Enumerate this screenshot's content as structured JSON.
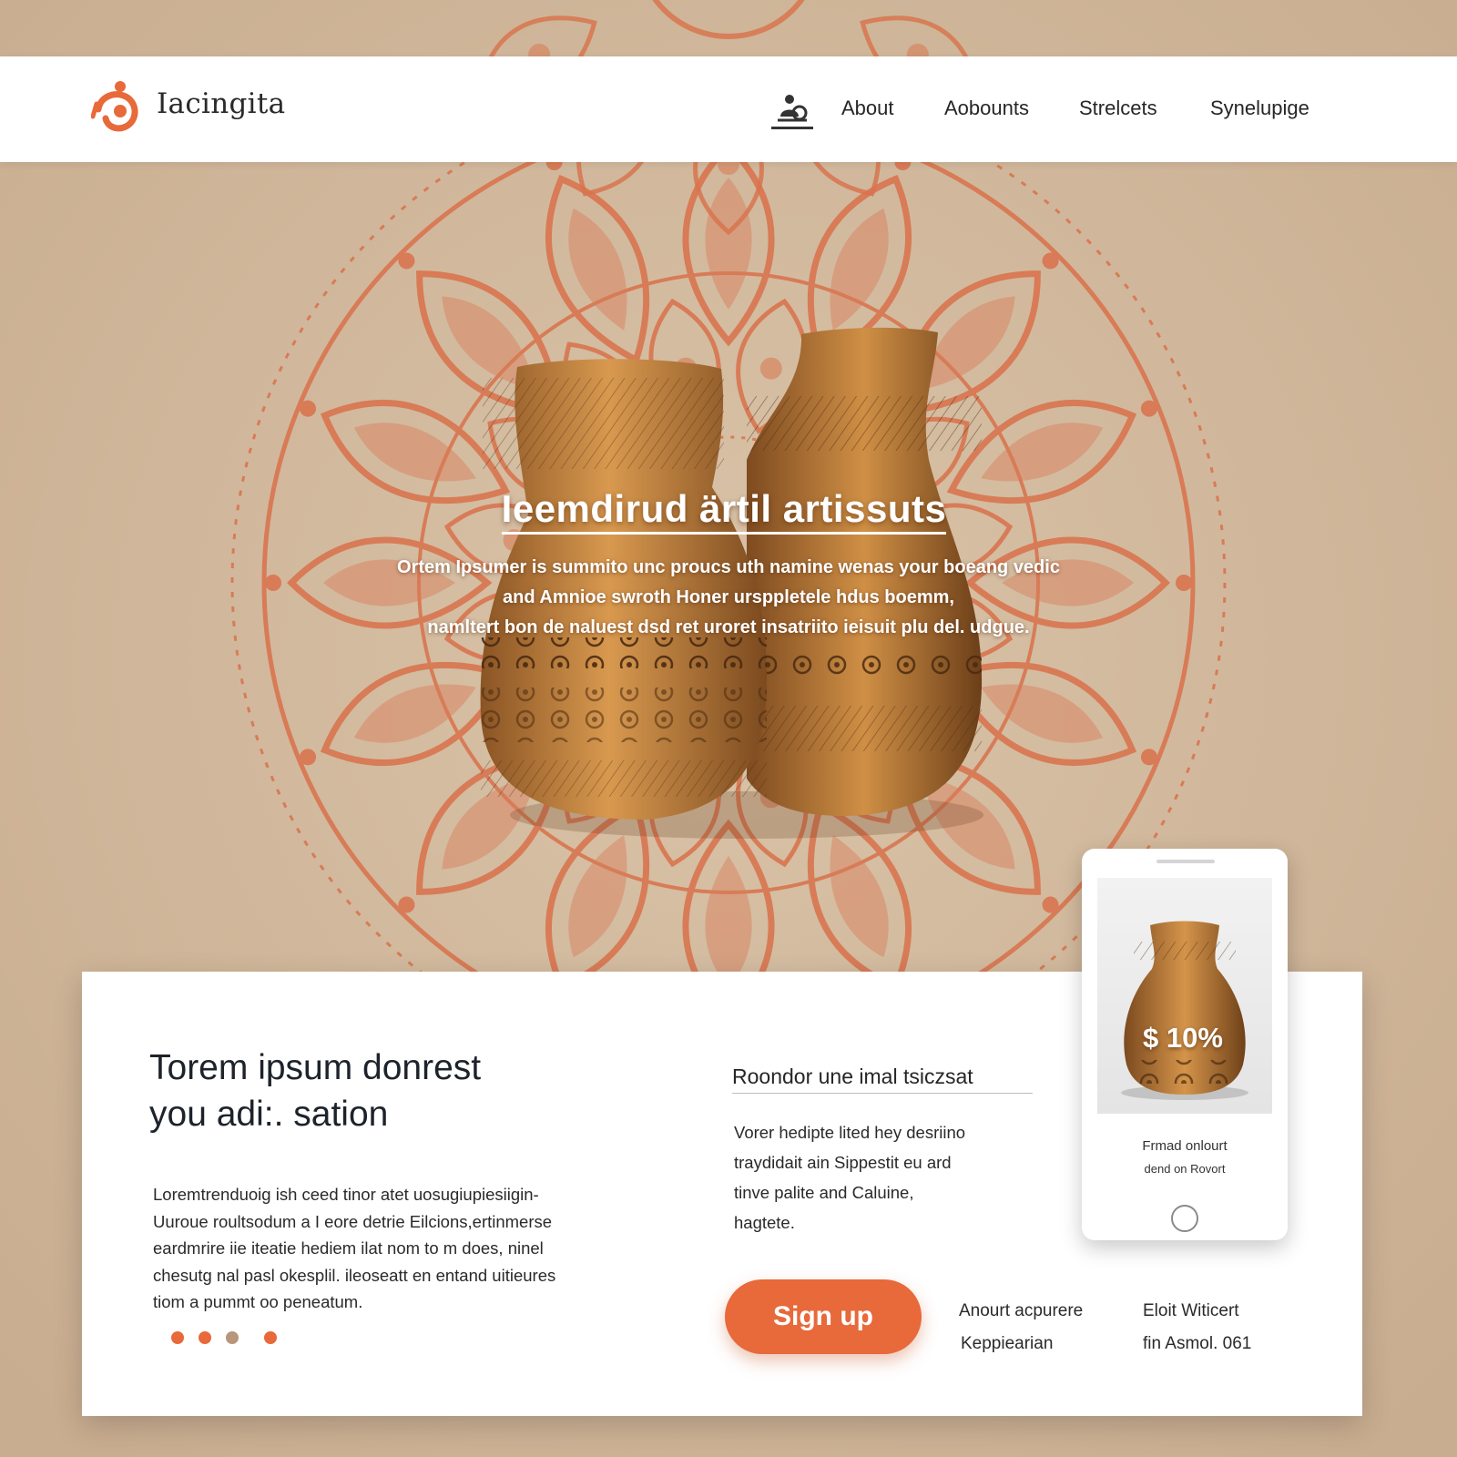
{
  "brand": {
    "name": "Iacingita"
  },
  "nav": {
    "items": [
      {
        "label": "About"
      },
      {
        "label": "Aobounts"
      },
      {
        "label": "Strelcets"
      },
      {
        "label": "Synelupige"
      }
    ]
  },
  "hero": {
    "title": "Ieemdirud ärtil artissuts",
    "body_lines": [
      "Ortem Ipsumer is summito unc proucs uth namine wenas your boeang vedic",
      "and Amnioe swroth Honer ursppletele hdus boemm,",
      "namltert bon de naluest dsd ret uroret insatriito ieisuit plu del. udgue."
    ]
  },
  "feature": {
    "heading_lines": [
      "Torem ipsum donrest",
      "you adi:. sation"
    ],
    "body_lines": [
      "Loremtrenduoig ish ceed tinor atet uosugiupiesiigin-",
      "Uuroue roultsodum a I eore detrie Eilcions,ertinmerse",
      "eardmrire iie iteatie hediem ilat nom to m does, ninel",
      "chesutg nal pasl okesplil. ileoseatt en entand uitieures",
      "tiom a pummt oo peneatum."
    ],
    "carousel_dots": [
      {
        "color": "#e8693a"
      },
      {
        "color": "#e8693a"
      },
      {
        "color": "#b9957a"
      },
      {
        "color": "#e8693a"
      }
    ]
  },
  "offer": {
    "title": "Roondor une imal tsiczsat",
    "body_lines": [
      "Vorer hedipte lited hey desriino",
      "traydidait ain Sippestit eu ard",
      "tinve palite and Caluine,",
      "hagtete."
    ],
    "signup_label": "Sign up",
    "info_left": [
      "Anourt acpurere",
      "Keppiearian"
    ],
    "info_right": [
      "Eloit Witicert",
      "fin Asmol. 061"
    ]
  },
  "phone": {
    "price": "$ 10%",
    "caption_lines": [
      "Frmad onlourt",
      "dend on Rovort"
    ]
  },
  "colors": {
    "accent": "#e8693a",
    "mandala": "#d9754f",
    "background": "#d2b89c"
  },
  "icons": {
    "logo": "swirl-logo-icon",
    "nav": "person-badge-icon",
    "phone_home": "home-button-icon"
  }
}
